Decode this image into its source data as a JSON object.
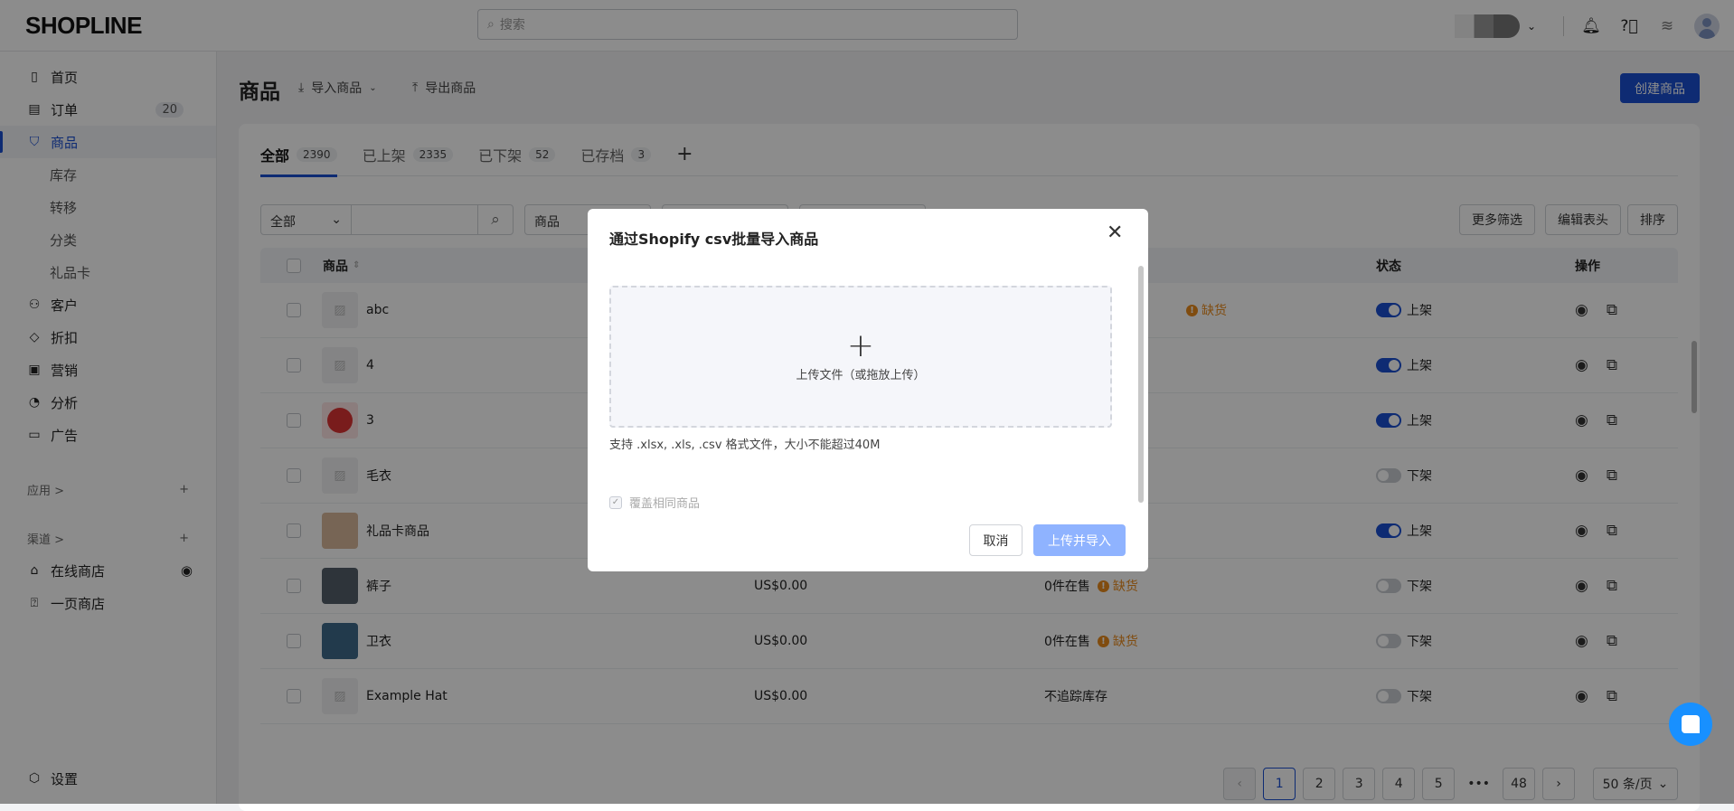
{
  "header": {
    "logo": "SHOPLINE",
    "search_placeholder": "搜索"
  },
  "sidebar": {
    "items": [
      {
        "label": "首页",
        "icon": "home-icon"
      },
      {
        "label": "订单",
        "icon": "order-icon",
        "badge": "20"
      },
      {
        "label": "商品",
        "icon": "bag-icon"
      }
    ],
    "sub_items": [
      "库存",
      "转移",
      "分类",
      "礼品卡"
    ],
    "items2": [
      {
        "label": "客户",
        "icon": "user-icon"
      },
      {
        "label": "折扣",
        "icon": "tag-icon"
      },
      {
        "label": "营销",
        "icon": "marketing-icon"
      },
      {
        "label": "分析",
        "icon": "analytics-icon"
      },
      {
        "label": "广告",
        "icon": "ads-icon"
      }
    ],
    "apps_label": "应用 >",
    "channels_label": "渠道 >",
    "channels": [
      "在线商店",
      "一页商店"
    ],
    "settings": "设置"
  },
  "page": {
    "title": "商品",
    "import_label": "导入商品",
    "export_label": "导出商品",
    "create_label": "创建商品"
  },
  "tabs": [
    {
      "label": "全部",
      "count": "2390"
    },
    {
      "label": "已上架",
      "count": "2335"
    },
    {
      "label": "已下架",
      "count": "52"
    },
    {
      "label": "已存档",
      "count": "3"
    }
  ],
  "filters": {
    "scope": "全部",
    "dd1": "商品",
    "more": "更多筛选",
    "edit_columns": "编辑表头",
    "sort": "排序"
  },
  "table": {
    "headers": {
      "product": "商品",
      "status": "状态",
      "actions": "操作"
    },
    "rows": [
      {
        "name": "abc",
        "price": "",
        "inventory": "",
        "stock": "缺货",
        "status": "上架",
        "on": true
      },
      {
        "name": "4",
        "price": "",
        "inventory": "",
        "stock": "",
        "status": "上架",
        "on": true
      },
      {
        "name": "3",
        "price": "",
        "inventory": "",
        "stock": "",
        "status": "上架",
        "on": true
      },
      {
        "name": "毛衣",
        "price": "",
        "inventory": "",
        "stock": "",
        "status": "下架",
        "on": false
      },
      {
        "name": "礼品卡商品",
        "price": "",
        "inventory": "",
        "stock": "",
        "status": "上架",
        "on": true
      },
      {
        "name": "裤子",
        "price": "US$0.00",
        "inventory": "0件在售",
        "stock": "缺货",
        "status": "下架",
        "on": false
      },
      {
        "name": "卫衣",
        "price": "US$0.00",
        "inventory": "0件在售",
        "stock": "缺货",
        "status": "下架",
        "on": false
      },
      {
        "name": "Example Hat",
        "price": "US$0.00",
        "inventory": "不追踪库存",
        "stock": "",
        "status": "下架",
        "on": false
      }
    ]
  },
  "pagination": {
    "pages": [
      "1",
      "2",
      "3",
      "4",
      "5"
    ],
    "ellipsis": "•••",
    "last": "48",
    "current": "1",
    "page_size": "50 条/页"
  },
  "modal": {
    "title": "通过Shopify csv批量导入商品",
    "upload_label": "上传文件（或拖放上传）",
    "hint": "支持 .xlsx, .xls, .csv 格式文件，大小不能超过40M",
    "overwrite_label": "覆盖相同商品",
    "overwrite_checked": true,
    "cancel": "取消",
    "submit": "上传并导入"
  },
  "colors": {
    "primary": "#1a4fd1",
    "warning": "#e98b1d",
    "chat": "#1890ff"
  }
}
